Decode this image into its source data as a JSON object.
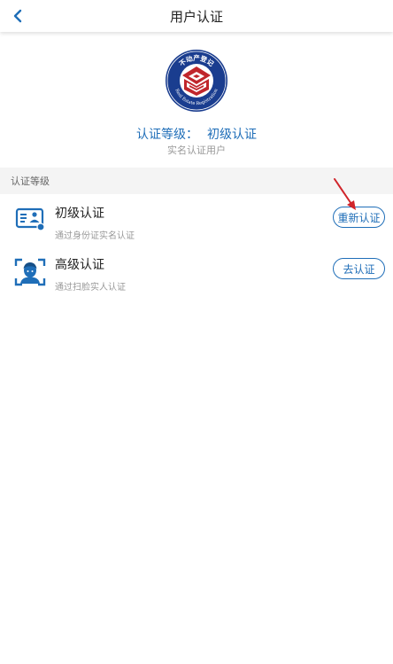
{
  "header": {
    "title": "用户认证",
    "back_icon": "chevron-left-icon"
  },
  "emblem": {
    "top_text": "不动产登记",
    "bottom_text": "Real Estate Registration"
  },
  "certification": {
    "level_label": "认证等级：",
    "level_value": "初级认证",
    "subtitle": "实名认证用户"
  },
  "section": {
    "title": "认证等级"
  },
  "levels": [
    {
      "title": "初级认证",
      "description": "通过身份证实名认证",
      "button_label": "重新认证",
      "icon": "id-card-icon"
    },
    {
      "title": "高级认证",
      "description": "通过扫脸实人认证",
      "button_label": "去认证",
      "icon": "face-scan-icon"
    }
  ],
  "colors": {
    "accent": "#1f6eb8",
    "annotation_arrow": "#d0242a",
    "emblem_ring": "#1a3d8f",
    "emblem_red": "#c0262c"
  }
}
